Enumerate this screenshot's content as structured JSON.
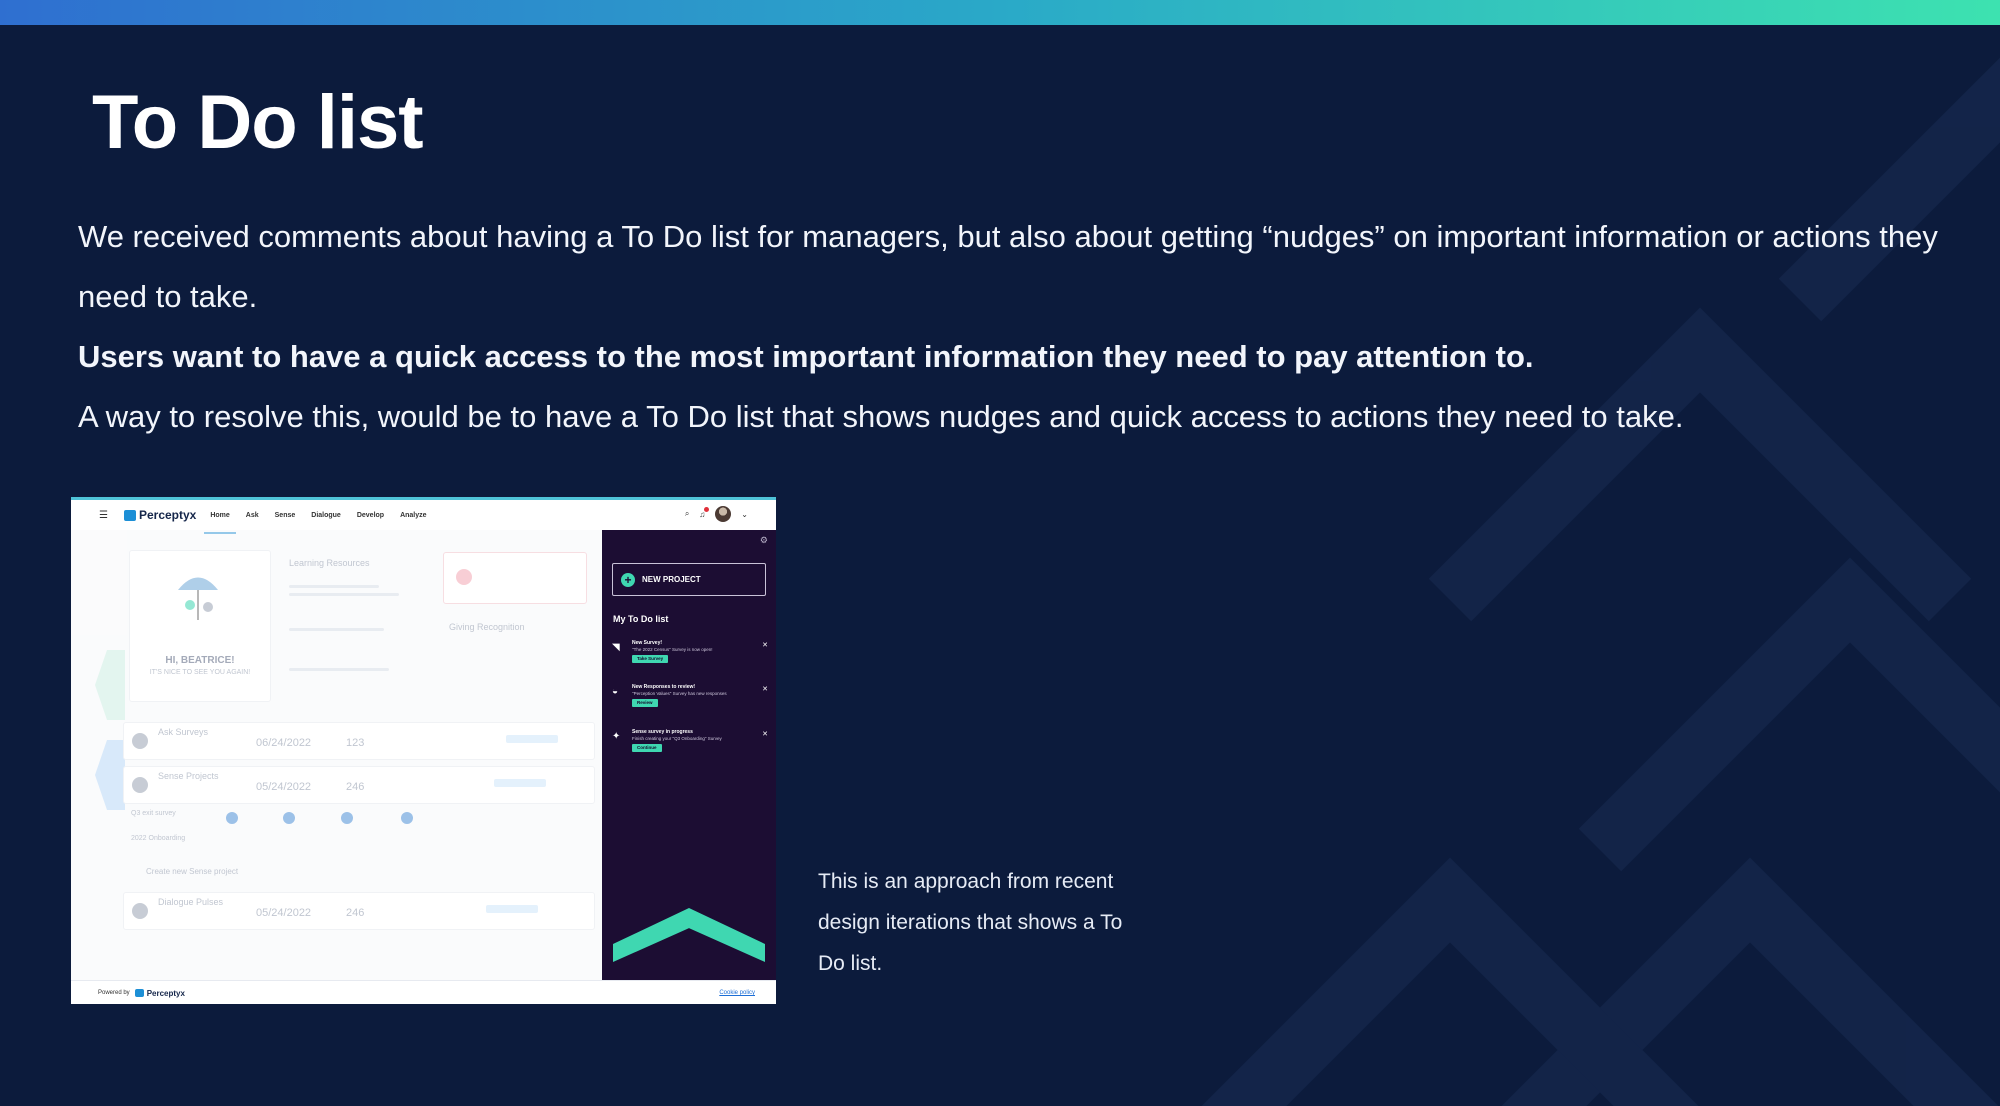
{
  "slide": {
    "title": "To Do list",
    "paragraph_1": "We received comments about having a To Do list for managers, but also about getting “nudges” on important information or actions they need to take.",
    "paragraph_2": "Users want to have a quick access to the most important information they need to pay attention to.",
    "paragraph_3": "A way to resolve this, would be to have a To Do list that shows nudges and quick access to actions they need to take.",
    "caption": "This is an approach from recent design iterations that shows a To Do list."
  },
  "colors": {
    "background": "#0c1b3c",
    "accent_teal": "#3fd7b1",
    "panel_purple": "#1c0d33",
    "brand_blue": "#1c8fd6"
  },
  "screenshot": {
    "nav": {
      "menu_icon": "hamburger-icon",
      "brand": "Perceptyx",
      "tabs": [
        "Home",
        "Ask",
        "Sense",
        "Dialogue",
        "Develop",
        "Analyze"
      ],
      "active_tab": "Home"
    },
    "background_content": {
      "greeting": "HI, BEATRICE!",
      "greeting_sub": "IT'S NICE TO SEE YOU AGAIN!",
      "learning_resources": "Learning Resources",
      "giving_recognition": "Giving Recognition",
      "rows": [
        {
          "label": "Ask Surveys",
          "date": "06/24/2022",
          "count": "123"
        },
        {
          "label": "Sense Projects",
          "date": "05/24/2022",
          "count": "246"
        },
        {
          "label": "Dialogue Pulses",
          "date": "05/24/2022",
          "count": "246"
        }
      ],
      "sub_rows": [
        "Q3 exit survey",
        "2022 Onboarding"
      ],
      "create_link": "Create new Sense project"
    },
    "todo": {
      "new_project_label": "NEW PROJECT",
      "list_title": "My To Do list",
      "items": [
        {
          "title": "New Survey!",
          "desc": "\"The 2022 Census\" Survey is now open!",
          "action": "Take Survey",
          "icon": "megaphone-icon"
        },
        {
          "title": "New Responses to review!",
          "desc": "\"Perception Values\" Survey has new responses",
          "action": "Review",
          "icon": "chat-bubble-icon"
        },
        {
          "title": "Sense survey in progress",
          "desc": "Finish creating your \"Q3 Onboarding\" Survey",
          "action": "Continue",
          "icon": "sparkle-icon"
        }
      ]
    },
    "footer": {
      "powered_by": "Powered by",
      "brand": "Perceptyx",
      "cookie_policy": "Cookie policy"
    }
  }
}
